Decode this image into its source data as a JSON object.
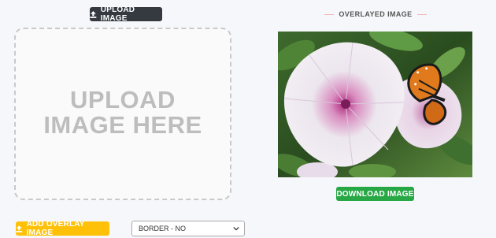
{
  "upload_button": {
    "label": "UPLOAD IMAGE",
    "icon": "upload-icon"
  },
  "upload_area": {
    "line1": "UPLOAD",
    "line2": "IMAGE HERE"
  },
  "overlay": {
    "title": "OVERLAYED IMAGE"
  },
  "download_button": {
    "label": "DOWNLOAD IMAGE"
  },
  "add_overlay_button": {
    "label": "ADD OVERLAY IMAGE",
    "icon": "upload-icon"
  },
  "border_select": {
    "value": "BORDER - NO"
  },
  "colors": {
    "dark": "#343a40",
    "green": "#28a745",
    "yellow": "#ffc107",
    "dashed_border": "#c9c9c9",
    "title_rule": "#f3b7b7"
  }
}
